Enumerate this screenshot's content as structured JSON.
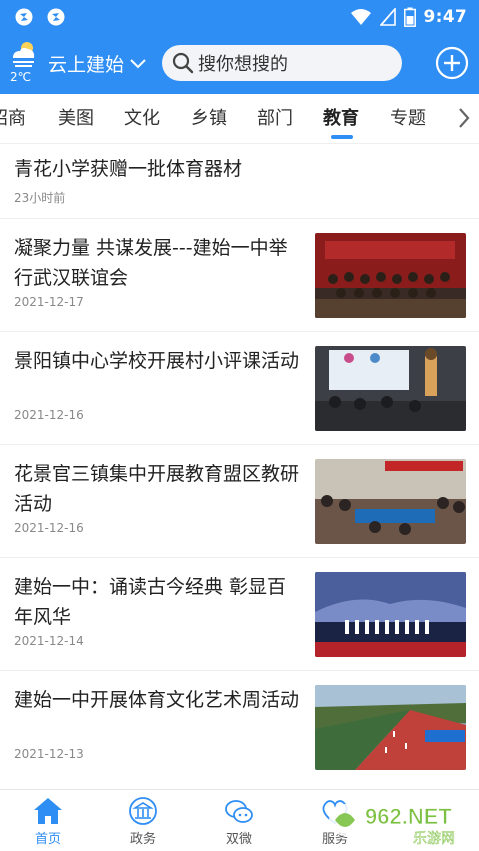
{
  "status": {
    "time": "9:47"
  },
  "topbar": {
    "temperature": "2℃",
    "city": "云上建始",
    "search_placeholder": "搜你想搜的"
  },
  "tabs": [
    "招商",
    "美图",
    "文化",
    "乡镇",
    "部门",
    "教育",
    "专题"
  ],
  "active_tab": "教育",
  "news": [
    {
      "title": "青花小学获赠一批体育器材",
      "date": "23小时前"
    },
    {
      "title": "凝聚力量 共谋发展---建始一中举行武汉联谊会",
      "date": "2021-12-17"
    },
    {
      "title": "景阳镇中心学校开展村小评课活动",
      "date": "2021-12-16"
    },
    {
      "title": "花景官三镇集中开展教育盟区教研活动",
      "date": "2021-12-16"
    },
    {
      "title": "建始一中：诵读古今经典 彰显百年风华",
      "date": "2021-12-14"
    },
    {
      "title": "建始一中开展体育文化艺术周活动",
      "date": "2021-12-13"
    }
  ],
  "bottom_nav": [
    "首页",
    "政务",
    "双微",
    "服务"
  ],
  "watermark": {
    "brand": "962.NET",
    "sub": "乐游网"
  },
  "colors": {
    "primary": "#2f8ef4",
    "text": "#222222",
    "muted": "#888888"
  }
}
